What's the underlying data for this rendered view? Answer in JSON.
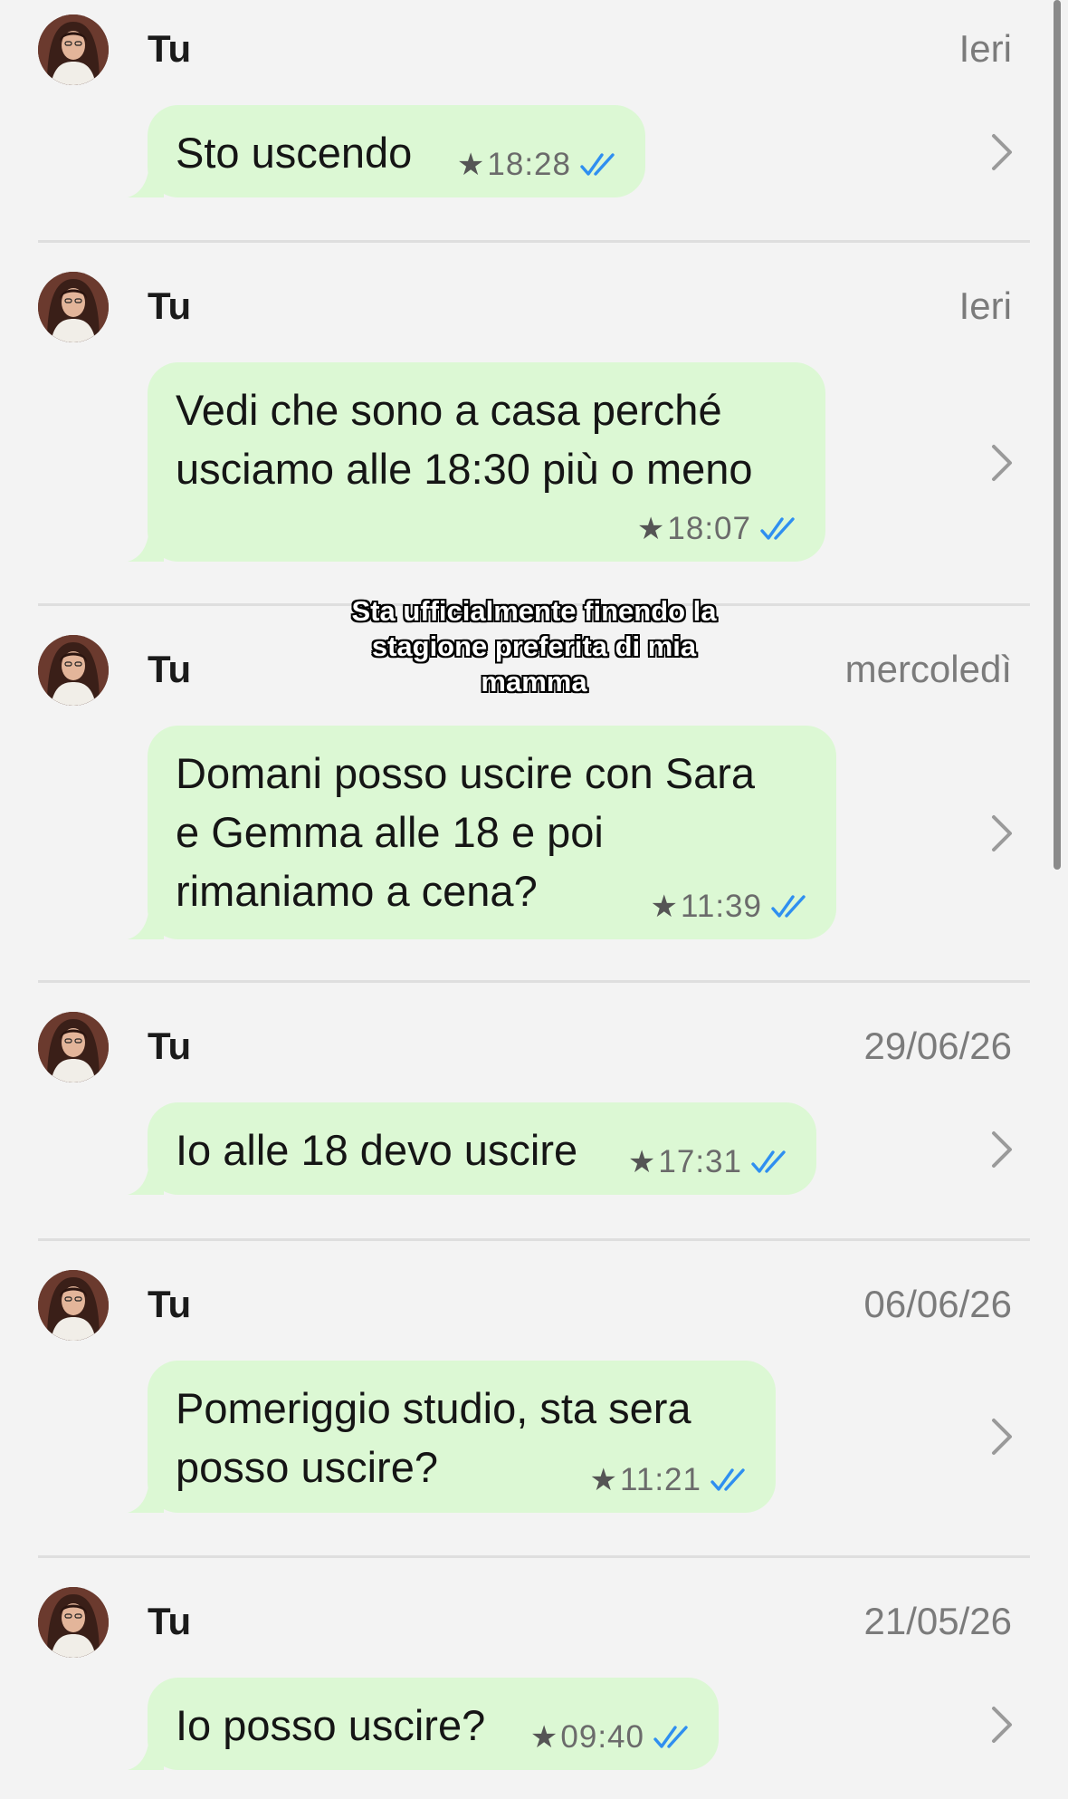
{
  "sender_label": "Tu",
  "colors": {
    "bubble": "#dcf8d4",
    "tick": "#2f8ff0",
    "date": "#7b7b7b",
    "background": "#f3f3f3"
  },
  "icons": {
    "star": "star-icon",
    "read_receipt": "double-check-icon",
    "chevron": "chevron-right-icon"
  },
  "messages": [
    {
      "sender": "Tu",
      "date": "Ieri",
      "text": "Sto uscendo",
      "time": "18:28",
      "starred": true,
      "read": true
    },
    {
      "sender": "Tu",
      "date": "Ieri",
      "text": "Vedi che sono a casa perché\nusciamo alle 18:30 più o meno",
      "time": "18:07",
      "starred": true,
      "read": true
    },
    {
      "sender": "Tu",
      "date": "mercoledì",
      "text": "Domani posso uscire con Sara\ne Gemma alle 18 e poi\nrimaniamo a cena?",
      "time": "11:39",
      "starred": true,
      "read": true
    },
    {
      "sender": "Tu",
      "date": "29/06/26",
      "text": "Io alle 18 devo uscire",
      "time": "17:31",
      "starred": true,
      "read": true
    },
    {
      "sender": "Tu",
      "date": "06/06/26",
      "text": "Pomeriggio studio, sta sera\nposso uscire?",
      "time": "11:21",
      "starred": true,
      "read": true
    },
    {
      "sender": "Tu",
      "date": "21/05/26",
      "text": "Io posso uscire?",
      "time": "09:40",
      "starred": true,
      "read": true
    }
  ],
  "overlay_caption": "Sta ufficialmente finendo la\nstagione preferita di mia\nmamma"
}
